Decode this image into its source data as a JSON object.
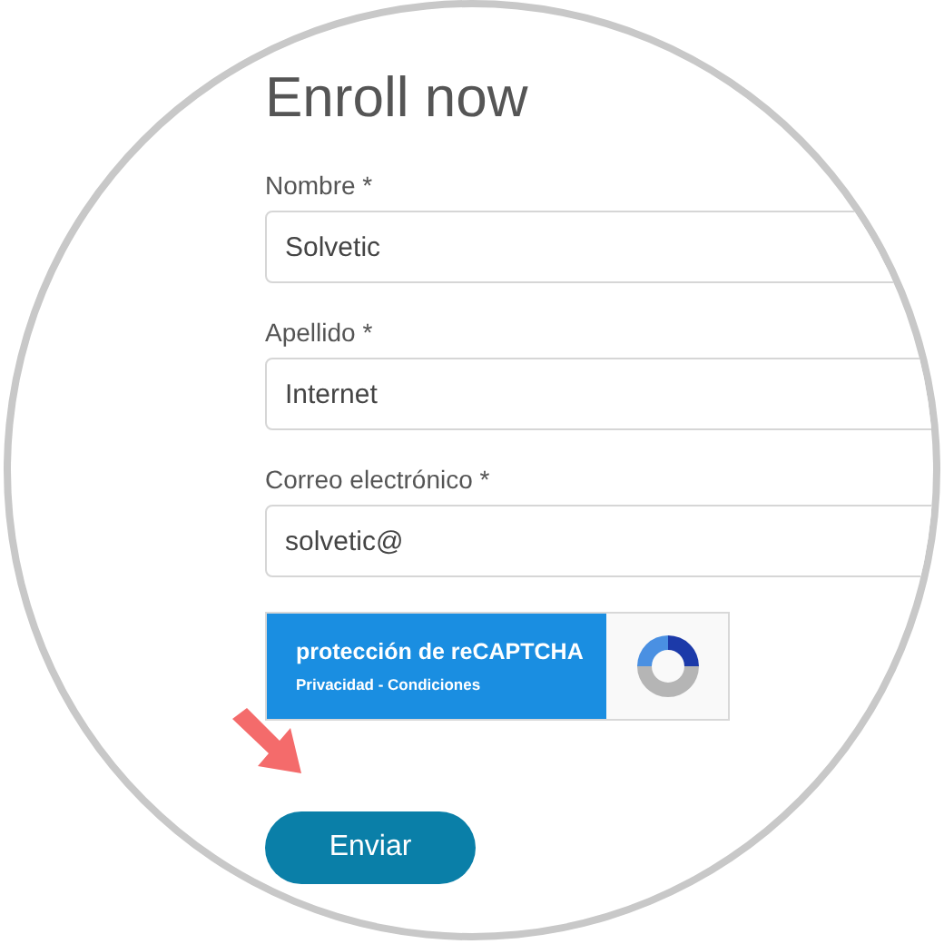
{
  "title": "Enroll now",
  "fields": [
    {
      "label": "Nombre *",
      "value": "Solvetic"
    },
    {
      "label": "Apellido *",
      "value": "Internet"
    },
    {
      "label": "Correo electrónico *",
      "value": "solvetic@"
    }
  ],
  "recaptcha": {
    "title": "protección de reCAPTCHA",
    "links": "Privacidad - Condiciones"
  },
  "submit_button": "Enviar"
}
